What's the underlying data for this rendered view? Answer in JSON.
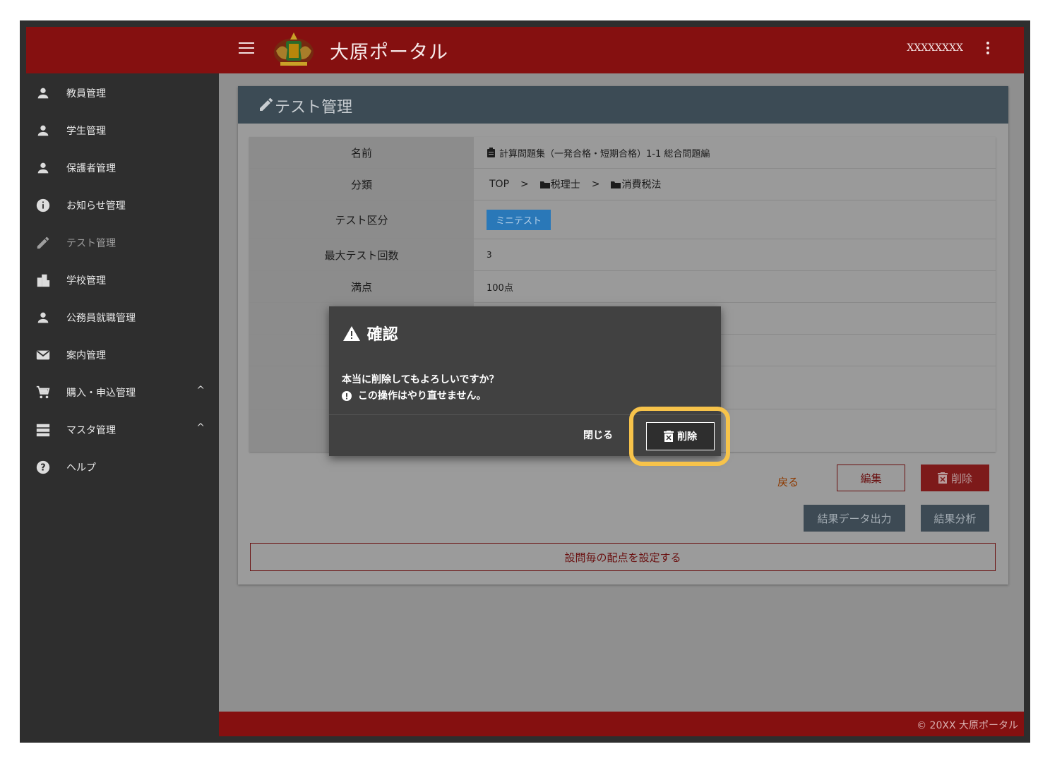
{
  "header": {
    "app_title": "大原ポータル",
    "user_name": "XXXXXXXX"
  },
  "sidebar": {
    "items": [
      {
        "label": "教員管理",
        "icon": "person-icon"
      },
      {
        "label": "学生管理",
        "icon": "person-icon"
      },
      {
        "label": "保護者管理",
        "icon": "person-icon"
      },
      {
        "label": "お知らせ管理",
        "icon": "info-icon"
      },
      {
        "label": "テスト管理",
        "icon": "pencil-icon",
        "active": true
      },
      {
        "label": "学校管理",
        "icon": "building-icon"
      },
      {
        "label": "公務員就職管理",
        "icon": "person-icon"
      },
      {
        "label": "案内管理",
        "icon": "mail-icon"
      },
      {
        "label": "購入・申込管理",
        "icon": "cart-icon",
        "expandable": true
      },
      {
        "label": "マスタ管理",
        "icon": "list-icon",
        "expandable": true
      },
      {
        "label": "ヘルプ",
        "icon": "help-icon"
      }
    ],
    "chevron": "^"
  },
  "page": {
    "title": "テスト管理",
    "fields": [
      {
        "key": "名前",
        "value": "計算問題集（一発合格・短期合格）1-1 総合問題編"
      },
      {
        "key": "分類",
        "breadcrumb": [
          "TOP",
          ">",
          "税理士",
          ">",
          "消費税法"
        ]
      },
      {
        "key": "テスト区分",
        "badge": "ミニテスト"
      },
      {
        "key": "最大テスト回数",
        "value": "3"
      },
      {
        "key": "満点",
        "value": "100点"
      }
    ],
    "buttons": {
      "back": "戻る",
      "edit": "編集",
      "delete": "削除",
      "export": "結果データ出力",
      "analysis": "結果分析",
      "set_points": "設問毎の配点を設定する"
    }
  },
  "dialog": {
    "title": "確認",
    "message": "本当に削除してもよろしいですか？",
    "warning": "この操作はやり直せません。",
    "close": "閉じる",
    "delete": "削除"
  },
  "footer": {
    "copyright": "© 20XX 大原ポータル"
  },
  "colors": {
    "header": "#851010",
    "sidebar": "#2e2e2e",
    "card_header": "#3c4b55",
    "highlight": "#f7c34a"
  }
}
